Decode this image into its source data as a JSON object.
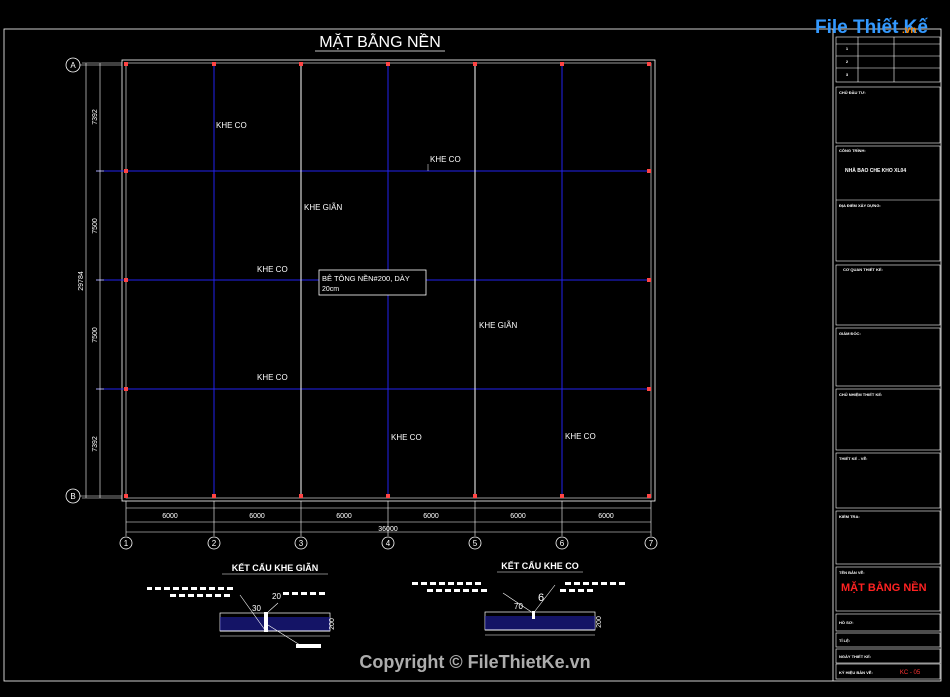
{
  "logo": {
    "text": "File Thiết Kế",
    "suffix": ".vn"
  },
  "title": "MẶT BẰNG NỀN",
  "watermark": "Copyright © FileThietKe.vn",
  "grid": {
    "column_labels": [
      "1",
      "2",
      "3",
      "4",
      "5",
      "6",
      "7"
    ],
    "row_labels": [
      "A",
      "B"
    ],
    "column_spacings": [
      "6000",
      "6000",
      "6000",
      "6000",
      "6000",
      "6000"
    ],
    "total_width": "36000",
    "row_spacings": [
      "7392",
      "7500",
      "7500",
      "7392"
    ],
    "total_height": "29784"
  },
  "annotations": {
    "khe_co": "KHE CO",
    "khe_gian": "KHE GIÃN",
    "note_line1": "BÊ TÔNG NỀN#200, DÀY",
    "note_line2": "20cm"
  },
  "details": {
    "gian_title": "KẾT CẤU KHE GIÃN",
    "gian_dims": [
      "20",
      "30",
      "200"
    ],
    "co_title": "KẾT CẤU KHE CO",
    "co_dims": [
      "6",
      "70",
      "200"
    ]
  },
  "title_block": {
    "rows": [
      "1",
      "2",
      "3"
    ],
    "chu_dau_tu": "CHỦ ĐẦU TƯ:",
    "cong_trinh": "CÔNG TRÌNH:",
    "ten_cong_trinh": "NHÀ BAO CHE KHO XL04",
    "dia_diem": "ĐỊA ĐIỂM XÂY DỰNG:",
    "co_quan_thiet_ke": "CƠ QUAN THIẾT KẾ:",
    "giam_doc": "GIÁM ĐỐC:",
    "chu_nhiem": "CHỦ NHIỆM THIẾT KẾ:",
    "thiet_ke": "THIẾT KẾ - VẼ:",
    "kiem_tra": "KIỂM TRA:",
    "ten_ban_ve_label": "TÊN BẢN VẼ:",
    "ten_ban_ve": "MẶT BẰNG NỀN",
    "ho_so": "HỒ SƠ:",
    "ti_le": "TỈ LỆ:",
    "ngay": "NGÀY THIẾT KẾ:",
    "ky_hieu_label": "KÝ HIỆU BẢN VẼ:",
    "ky_hieu": "KC - 05"
  },
  "colors": {
    "grid_blue": "#2222ee",
    "red": "#ff2222",
    "background": "#000000"
  }
}
